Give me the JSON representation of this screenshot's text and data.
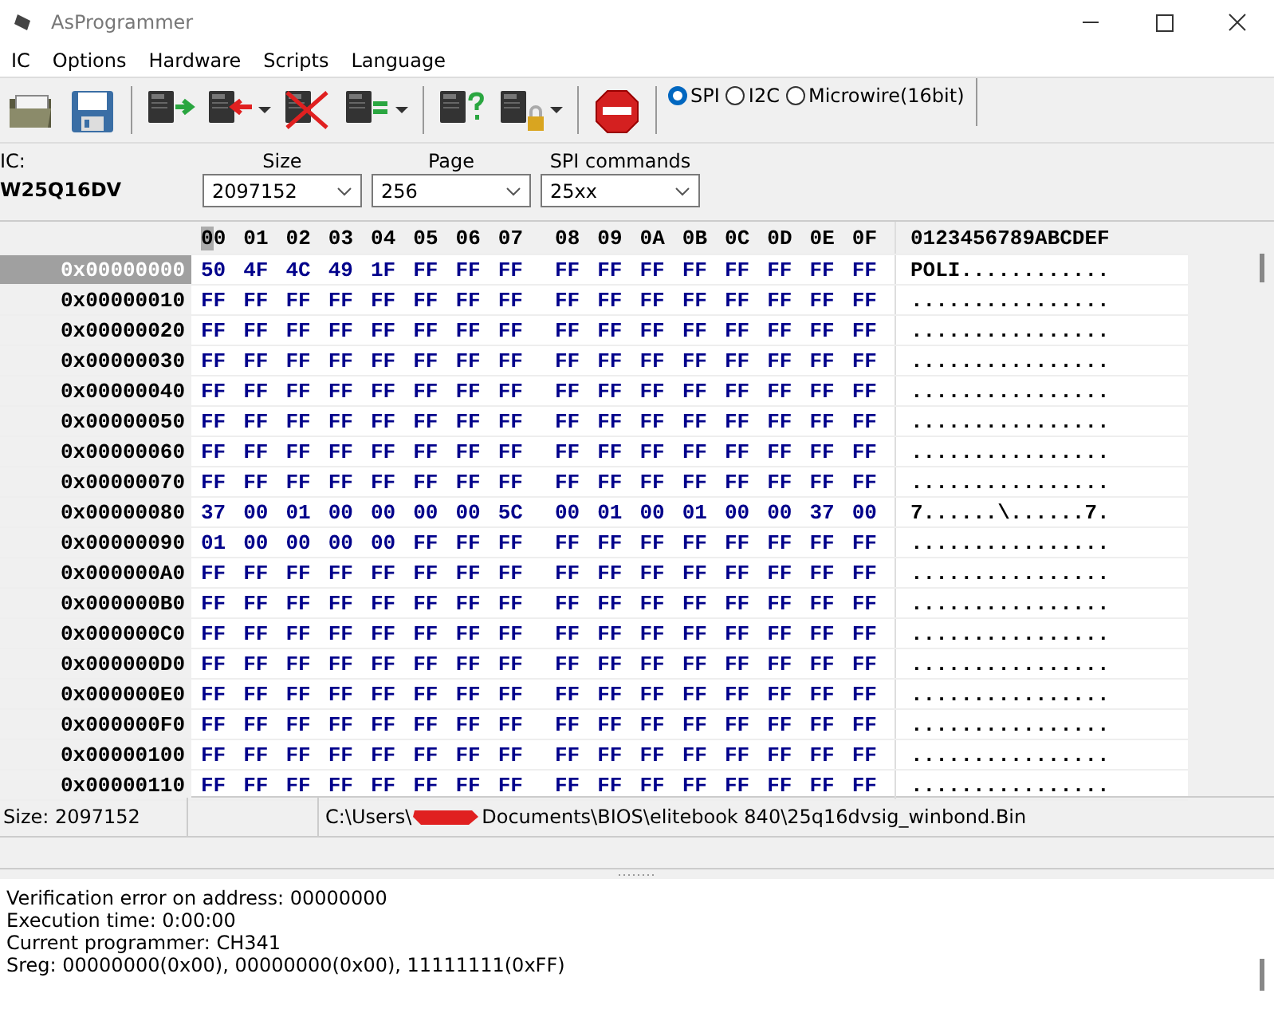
{
  "window": {
    "title": "AsProgrammer"
  },
  "menu": [
    "IC",
    "Options",
    "Hardware",
    "Scripts",
    "Language"
  ],
  "interfaces": [
    {
      "label": "SPI",
      "selected": true
    },
    {
      "label": "I2C",
      "selected": false
    },
    {
      "label": "Microwire(16bit)",
      "selected": false
    }
  ],
  "ic": {
    "label": "IC:",
    "name": "W25Q16DV"
  },
  "selectors": [
    {
      "label": "Size",
      "value": "2097152"
    },
    {
      "label": "Page",
      "value": "256"
    },
    {
      "label": "SPI commands",
      "value": "25xx"
    }
  ],
  "hex": {
    "columns": [
      {
        "label": "00",
        "selected": true
      },
      {
        "label": "01",
        "selected": false
      },
      {
        "label": "02",
        "selected": false
      },
      {
        "label": "03",
        "selected": false
      },
      {
        "label": "04",
        "selected": false
      },
      {
        "label": "05",
        "selected": false
      },
      {
        "label": "06",
        "selected": false
      },
      {
        "label": "07",
        "selected": false
      },
      {
        "label": "08",
        "selected": false
      },
      {
        "label": "09",
        "selected": false
      },
      {
        "label": "0A",
        "selected": false
      },
      {
        "label": "0B",
        "selected": false
      },
      {
        "label": "0C",
        "selected": false
      },
      {
        "label": "0D",
        "selected": false
      },
      {
        "label": "0E",
        "selected": false
      },
      {
        "label": "0F",
        "selected": false
      }
    ],
    "ascii_header": "0123456789ABCDEF",
    "rows": [
      {
        "address": "0x00000000",
        "selected": true,
        "bytes": [
          "50",
          "4F",
          "4C",
          "49",
          "1F",
          "FF",
          "FF",
          "FF",
          "FF",
          "FF",
          "FF",
          "FF",
          "FF",
          "FF",
          "FF",
          "FF"
        ],
        "ascii": "POLI............"
      },
      {
        "address": "0x00000010",
        "selected": false,
        "bytes": [
          "FF",
          "FF",
          "FF",
          "FF",
          "FF",
          "FF",
          "FF",
          "FF",
          "FF",
          "FF",
          "FF",
          "FF",
          "FF",
          "FF",
          "FF",
          "FF"
        ],
        "ascii": "................"
      },
      {
        "address": "0x00000020",
        "selected": false,
        "bytes": [
          "FF",
          "FF",
          "FF",
          "FF",
          "FF",
          "FF",
          "FF",
          "FF",
          "FF",
          "FF",
          "FF",
          "FF",
          "FF",
          "FF",
          "FF",
          "FF"
        ],
        "ascii": "................"
      },
      {
        "address": "0x00000030",
        "selected": false,
        "bytes": [
          "FF",
          "FF",
          "FF",
          "FF",
          "FF",
          "FF",
          "FF",
          "FF",
          "FF",
          "FF",
          "FF",
          "FF",
          "FF",
          "FF",
          "FF",
          "FF"
        ],
        "ascii": "................"
      },
      {
        "address": "0x00000040",
        "selected": false,
        "bytes": [
          "FF",
          "FF",
          "FF",
          "FF",
          "FF",
          "FF",
          "FF",
          "FF",
          "FF",
          "FF",
          "FF",
          "FF",
          "FF",
          "FF",
          "FF",
          "FF"
        ],
        "ascii": "................"
      },
      {
        "address": "0x00000050",
        "selected": false,
        "bytes": [
          "FF",
          "FF",
          "FF",
          "FF",
          "FF",
          "FF",
          "FF",
          "FF",
          "FF",
          "FF",
          "FF",
          "FF",
          "FF",
          "FF",
          "FF",
          "FF"
        ],
        "ascii": "................"
      },
      {
        "address": "0x00000060",
        "selected": false,
        "bytes": [
          "FF",
          "FF",
          "FF",
          "FF",
          "FF",
          "FF",
          "FF",
          "FF",
          "FF",
          "FF",
          "FF",
          "FF",
          "FF",
          "FF",
          "FF",
          "FF"
        ],
        "ascii": "................"
      },
      {
        "address": "0x00000070",
        "selected": false,
        "bytes": [
          "FF",
          "FF",
          "FF",
          "FF",
          "FF",
          "FF",
          "FF",
          "FF",
          "FF",
          "FF",
          "FF",
          "FF",
          "FF",
          "FF",
          "FF",
          "FF"
        ],
        "ascii": "................"
      },
      {
        "address": "0x00000080",
        "selected": false,
        "bytes": [
          "37",
          "00",
          "01",
          "00",
          "00",
          "00",
          "00",
          "5C",
          "00",
          "01",
          "00",
          "01",
          "00",
          "00",
          "37",
          "00"
        ],
        "ascii": "7......\\......7."
      },
      {
        "address": "0x00000090",
        "selected": false,
        "bytes": [
          "01",
          "00",
          "00",
          "00",
          "00",
          "FF",
          "FF",
          "FF",
          "FF",
          "FF",
          "FF",
          "FF",
          "FF",
          "FF",
          "FF",
          "FF"
        ],
        "ascii": "................"
      },
      {
        "address": "0x000000A0",
        "selected": false,
        "bytes": [
          "FF",
          "FF",
          "FF",
          "FF",
          "FF",
          "FF",
          "FF",
          "FF",
          "FF",
          "FF",
          "FF",
          "FF",
          "FF",
          "FF",
          "FF",
          "FF"
        ],
        "ascii": "................"
      },
      {
        "address": "0x000000B0",
        "selected": false,
        "bytes": [
          "FF",
          "FF",
          "FF",
          "FF",
          "FF",
          "FF",
          "FF",
          "FF",
          "FF",
          "FF",
          "FF",
          "FF",
          "FF",
          "FF",
          "FF",
          "FF"
        ],
        "ascii": "................"
      },
      {
        "address": "0x000000C0",
        "selected": false,
        "bytes": [
          "FF",
          "FF",
          "FF",
          "FF",
          "FF",
          "FF",
          "FF",
          "FF",
          "FF",
          "FF",
          "FF",
          "FF",
          "FF",
          "FF",
          "FF",
          "FF"
        ],
        "ascii": "................"
      },
      {
        "address": "0x000000D0",
        "selected": false,
        "bytes": [
          "FF",
          "FF",
          "FF",
          "FF",
          "FF",
          "FF",
          "FF",
          "FF",
          "FF",
          "FF",
          "FF",
          "FF",
          "FF",
          "FF",
          "FF",
          "FF"
        ],
        "ascii": "................"
      },
      {
        "address": "0x000000E0",
        "selected": false,
        "bytes": [
          "FF",
          "FF",
          "FF",
          "FF",
          "FF",
          "FF",
          "FF",
          "FF",
          "FF",
          "FF",
          "FF",
          "FF",
          "FF",
          "FF",
          "FF",
          "FF"
        ],
        "ascii": "................"
      },
      {
        "address": "0x000000F0",
        "selected": false,
        "bytes": [
          "FF",
          "FF",
          "FF",
          "FF",
          "FF",
          "FF",
          "FF",
          "FF",
          "FF",
          "FF",
          "FF",
          "FF",
          "FF",
          "FF",
          "FF",
          "FF"
        ],
        "ascii": "................"
      },
      {
        "address": "0x00000100",
        "selected": false,
        "bytes": [
          "FF",
          "FF",
          "FF",
          "FF",
          "FF",
          "FF",
          "FF",
          "FF",
          "FF",
          "FF",
          "FF",
          "FF",
          "FF",
          "FF",
          "FF",
          "FF"
        ],
        "ascii": "................"
      },
      {
        "address": "0x00000110",
        "selected": false,
        "bytes": [
          "FF",
          "FF",
          "FF",
          "FF",
          "FF",
          "FF",
          "FF",
          "FF",
          "FF",
          "FF",
          "FF",
          "FF",
          "FF",
          "FF",
          "FF",
          "FF"
        ],
        "ascii": "................"
      }
    ]
  },
  "status_bar": {
    "size": "Size: 2097152",
    "path_start": "C:\\Users\\",
    "path_end": "Documents\\BIOS\\elitebook 840\\25q16dvsig_winbond.Bin"
  },
  "log": [
    "Verification error on address: 00000000",
    "Execution time: 0:00:00",
    "Current programmer: CH341",
    "Sreg: 00000000(0x00), 00000000(0x00), 11111111(0xFF)"
  ]
}
